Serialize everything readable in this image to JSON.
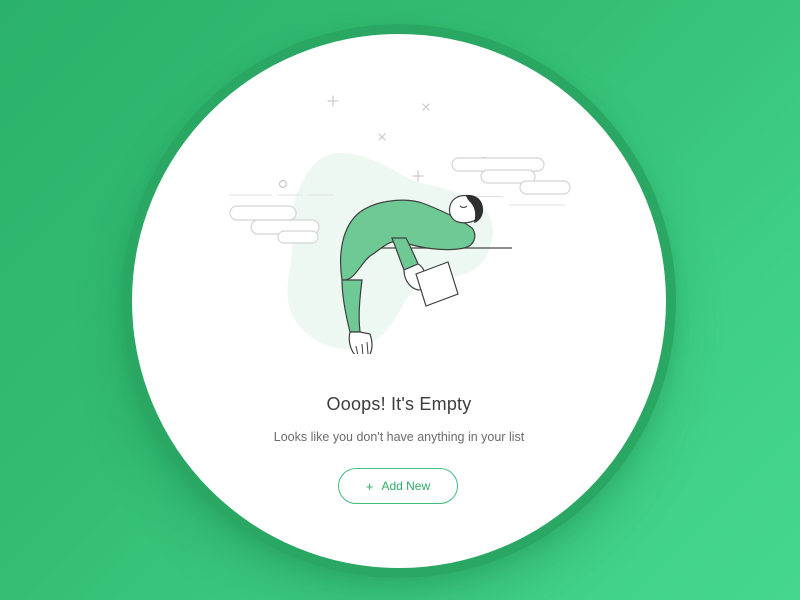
{
  "empty_state": {
    "title": "Ooops! It's Empty",
    "subtitle": "Looks like you don't have anything in your list",
    "button_label": "Add New",
    "button_icon": "+"
  },
  "colors": {
    "background": "#33bd72",
    "ring": "#2aa863",
    "accent": "#3fbf7c",
    "figure_green": "#6fc995",
    "blob": "#ecf8f1"
  }
}
